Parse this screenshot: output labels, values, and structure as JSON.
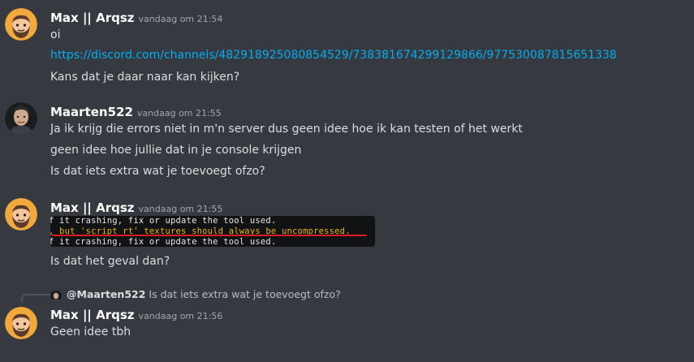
{
  "messages": [
    {
      "username": "Max || Arqsz",
      "timestamp": "vandaag om 21:54",
      "lines": [
        "oi",
        "https://discord.com/channels/482918925080854529/738381674299129866/977530087815651338",
        "Kans dat je daar naar kan kijken?"
      ]
    },
    {
      "username": "Maarten522",
      "timestamp": "vandaag om 21:55",
      "lines": [
        "Ja ik krijg die errors niet in m'n server dus geen idee hoe ik kan testen of het werkt",
        "geen idee hoe jullie dat in je console krijgen",
        "Is dat iets extra wat je toevoegt ofzo?"
      ]
    },
    {
      "username": "Max || Arqsz",
      "timestamp": "vandaag om 21:55",
      "code_lines": [
        "f it crashing, fix or update the tool used.",
        ", but 'script_rt' textures should always be uncompressed.",
        "f it crashing, fix or update the tool used."
      ],
      "lines": [
        "Is dat het geval dan?"
      ]
    },
    {
      "reply": {
        "user": "@Maarten522",
        "content": "Is dat iets extra wat je toevoegt ofzo?"
      },
      "username": "Max || Arqsz",
      "timestamp": "vandaag om 21:56",
      "lines": [
        "Geen idee tbh"
      ]
    }
  ],
  "colors": {
    "background": "#36393f",
    "link": "#00aff4",
    "username": "#ffffff",
    "timestamp": "#a3a6aa",
    "code_warning": "#e6b800",
    "underline": "#e01b24"
  },
  "icons": {
    "max_avatar": "cartoon-bearded-man-avatar-icon",
    "maarten_avatar": "photo-avatar-icon"
  }
}
